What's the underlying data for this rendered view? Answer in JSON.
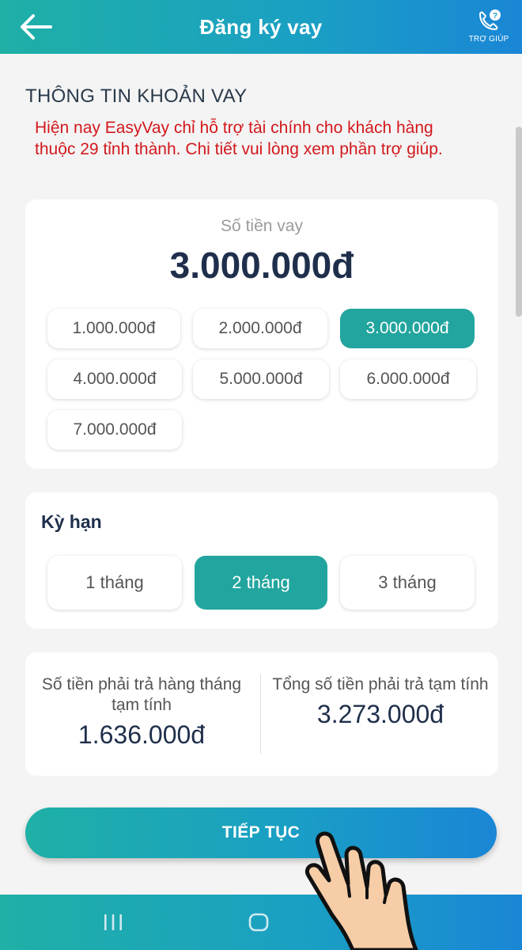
{
  "header": {
    "title": "Đăng ký vay",
    "help_label": "TRỢ GIÚP"
  },
  "section_title": "THÔNG TIN KHOẢN VAY",
  "notice": "Hiện nay EasyVay chỉ hỗ trợ tài chính cho khách hàng thuộc 29 tỉnh thành. Chi tiết vui lòng xem phần trợ giúp.",
  "amount": {
    "label": "Số tiền vay",
    "value": "3.000.000đ",
    "options": [
      "1.000.000đ",
      "2.000.000đ",
      "3.000.000đ",
      "4.000.000đ",
      "5.000.000đ",
      "6.000.000đ",
      "7.000.000đ"
    ],
    "selected": "3.000.000đ"
  },
  "term": {
    "title": "Kỳ hạn",
    "options": [
      "1 tháng",
      "2 tháng",
      "3 tháng"
    ],
    "selected": "2 tháng"
  },
  "summary": {
    "monthly_label": "Số tiền phải trả hàng tháng tạm tính",
    "monthly_value": "1.636.000đ",
    "total_label": "Tổng số tiền phải trả tạm tính",
    "total_value": "3.273.000đ"
  },
  "cta_label": "TIẾP TỤC",
  "colors": {
    "accent": "#22a59e",
    "notice": "#d2181c",
    "header_gradient_start": "#1fb0a6",
    "header_gradient_end": "#1a86d6"
  },
  "icons": [
    "back-arrow-icon",
    "help-phone-icon",
    "recent-apps-icon",
    "home-icon",
    "pointing-hand-icon"
  ]
}
